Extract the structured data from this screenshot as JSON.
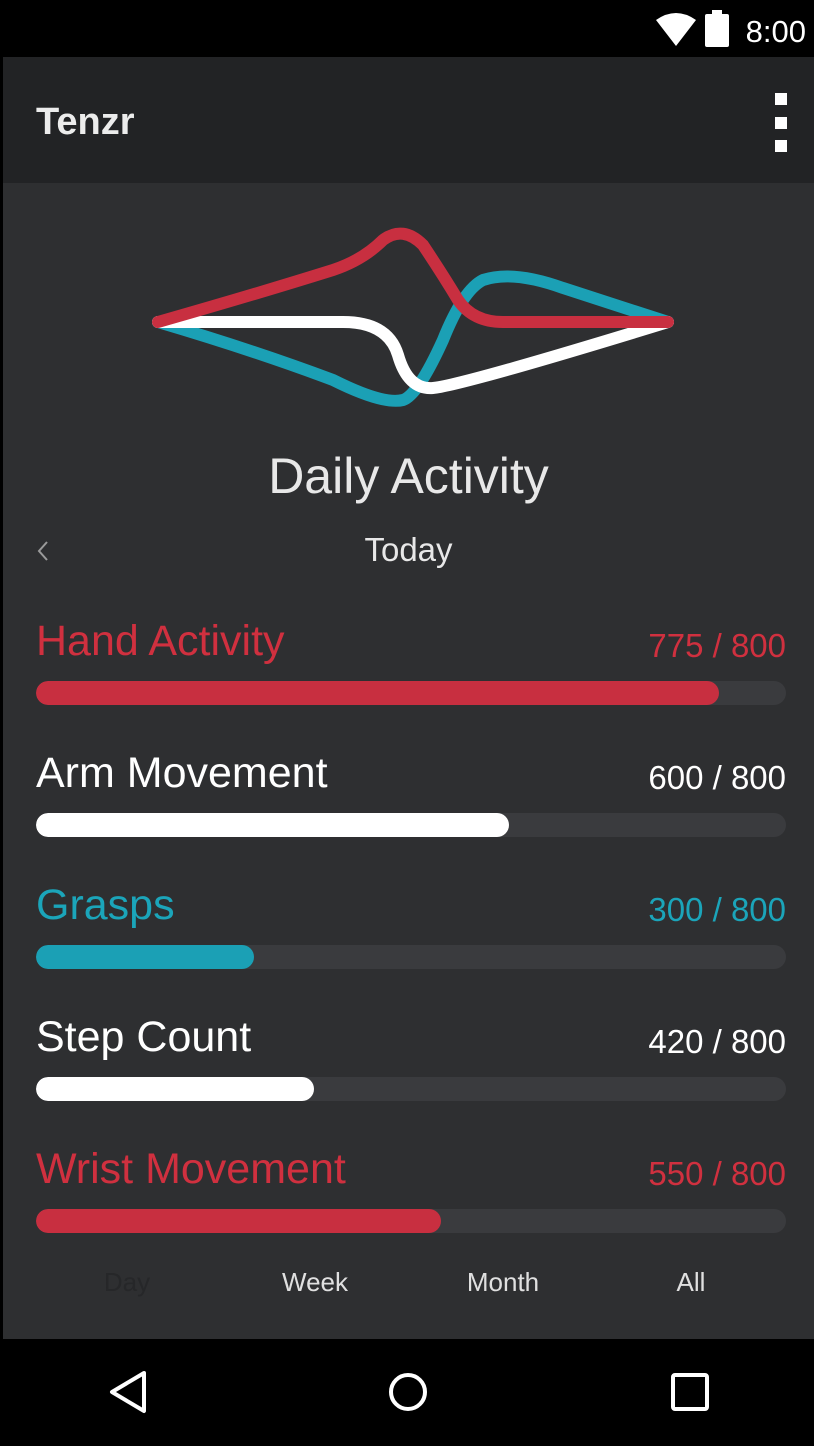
{
  "status_bar": {
    "time": "8:00"
  },
  "app_bar": {
    "title": "Tenzr"
  },
  "main": {
    "heading": "Daily Activity",
    "date_label": "Today"
  },
  "metrics": [
    {
      "name": "Hand Activity",
      "value": "775 / 800",
      "fraction": 0.91,
      "color": "#c82f40",
      "text_color": "#d0303f"
    },
    {
      "name": "Arm Movement",
      "value": "600 / 800",
      "fraction": 0.63,
      "color": "#ffffff",
      "text_color": "#ffffff"
    },
    {
      "name": "Grasps",
      "value": "300 / 800",
      "fraction": 0.29,
      "color": "#1ba0b5",
      "text_color": "#1ba5ba"
    },
    {
      "name": "Step Count",
      "value": "420 / 800",
      "fraction": 0.37,
      "color": "#ffffff",
      "text_color": "#ffffff"
    },
    {
      "name": "Wrist Movement",
      "value": "550 / 800",
      "fraction": 0.54,
      "color": "#c82f40",
      "text_color": "#d0303f"
    }
  ],
  "period_tabs": [
    {
      "label": "Day",
      "active": true
    },
    {
      "label": "Week",
      "active": false
    },
    {
      "label": "Month",
      "active": false
    },
    {
      "label": "All",
      "active": false
    }
  ],
  "icons": {
    "status": [
      "wifi-icon",
      "battery-icon"
    ],
    "app_bar": "more-vert-icon",
    "date_nav": "chevron-left-icon",
    "nav_bar": [
      "back-icon",
      "home-icon",
      "recents-icon"
    ]
  },
  "colors": {
    "accent_red": "#c82f40",
    "accent_teal": "#1ba0b5",
    "background": "#2e2f31",
    "app_bar": "#222325"
  }
}
